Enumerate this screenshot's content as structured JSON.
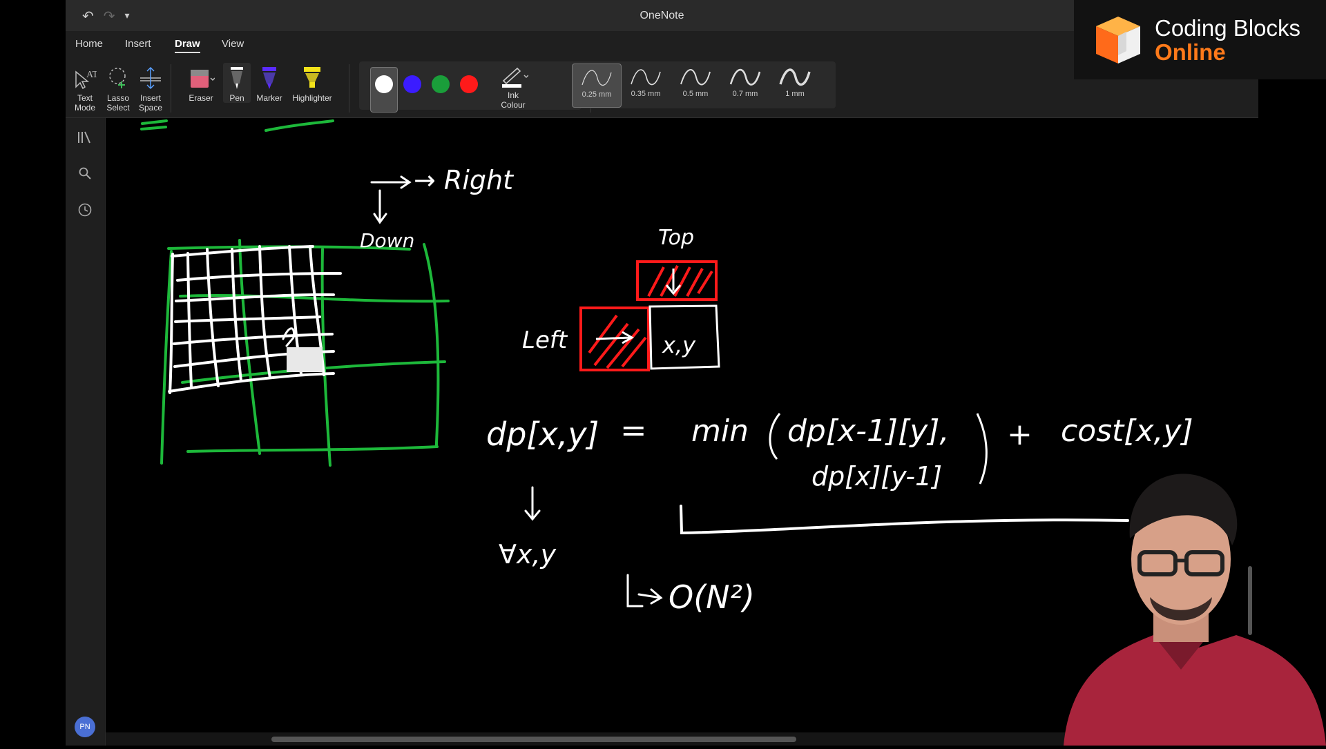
{
  "window": {
    "title": "OneNote",
    "qat": {
      "undo": "↶",
      "redo": "↷",
      "customize": "▾"
    }
  },
  "menu": {
    "items": [
      "Home",
      "Insert",
      "Draw",
      "View"
    ],
    "active": "Draw"
  },
  "ribbon": {
    "tools": {
      "text_mode": "Text Mode",
      "lasso_select": "Lasso Select",
      "insert_space": "Insert Space",
      "eraser": "Eraser",
      "pen": "Pen",
      "marker": "Marker",
      "highlighter": "Highlighter",
      "ink_colour": "Ink Colour"
    },
    "colors": [
      "#ffffff",
      "#3b1cff",
      "#1a9e3a",
      "#ff1a1a"
    ],
    "selected_color": "#ffffff",
    "widths": [
      "0.25 mm",
      "0.35 mm",
      "0.5 mm",
      "0.7 mm",
      "1 mm"
    ],
    "selected_width": "0.25 mm"
  },
  "sidebar": {
    "avatar": "PN",
    "icons": [
      "notebooks-icon",
      "search-icon",
      "recent-icon"
    ]
  },
  "ink": {
    "right": "→ Right",
    "down": "Down",
    "top": "Top",
    "left": "Left",
    "cell": "x,y",
    "lhs": "dp[x,y]",
    "eq": "=",
    "min": "min",
    "term1": "dp[x-1][y],",
    "term2": "dp[x][y-1]",
    "plus": "+",
    "cost": "cost[x,y]",
    "forall": "∀x,y",
    "complexity": "O(N²)"
  },
  "overlay": {
    "brand1": "Coding Blocks",
    "brand2": "Online"
  },
  "theme": {
    "green": "#1db83a",
    "red": "#ff1a1a",
    "ink": "#ffffff",
    "orange": "#ff7a1a"
  }
}
